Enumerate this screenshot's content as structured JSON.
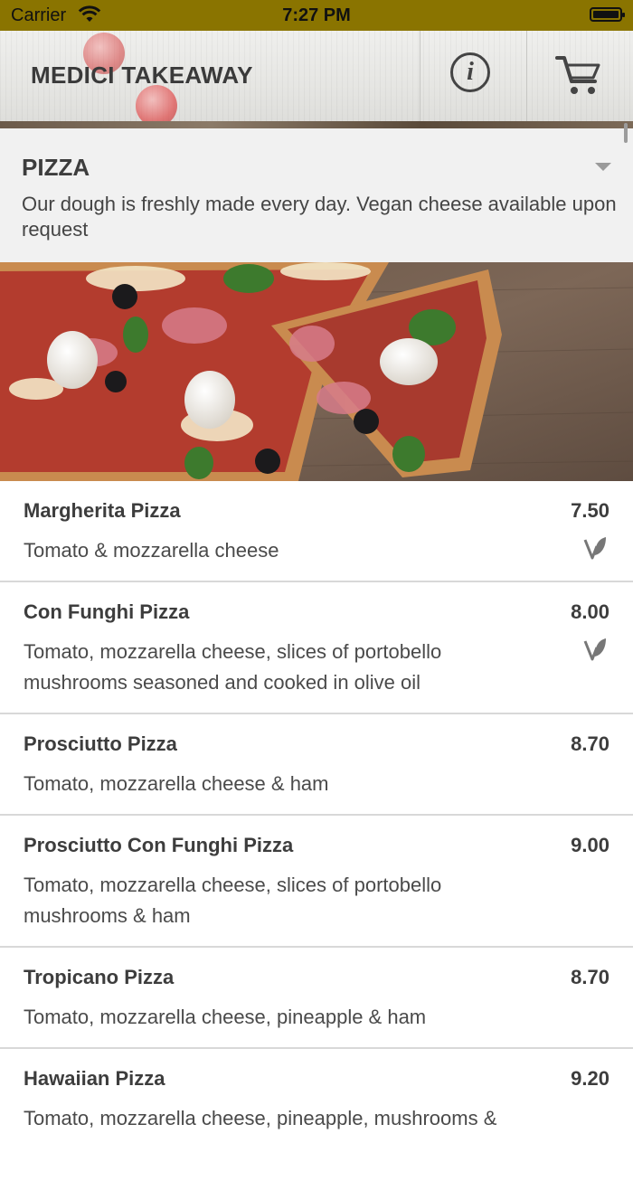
{
  "status_bar": {
    "carrier": "Carrier",
    "time": "7:27 PM"
  },
  "header": {
    "title": "MEDICI TAKEAWAY",
    "info_icon": "info-icon",
    "cart_icon": "cart-icon"
  },
  "category": {
    "title": "PIZZA",
    "description": "Our dough is freshly made every day. Vegan cheese available upon request",
    "toggle_icon": "chevron-down-icon"
  },
  "items": [
    {
      "name": "Margherita Pizza",
      "price": "7.50",
      "description": "Tomato & mozzarella cheese",
      "vegetarian": true
    },
    {
      "name": "Con Funghi Pizza",
      "price": "8.00",
      "description": "Tomato, mozzarella cheese, slices of portobello mushrooms seasoned and cooked in olive oil",
      "vegetarian": true
    },
    {
      "name": "Prosciutto Pizza",
      "price": "8.70",
      "description": "Tomato, mozzarella cheese & ham",
      "vegetarian": false
    },
    {
      "name": "Prosciutto Con Funghi Pizza",
      "price": "9.00",
      "description": "Tomato, mozzarella cheese, slices of portobello mushrooms & ham",
      "vegetarian": false
    },
    {
      "name": "Tropicano Pizza",
      "price": "8.70",
      "description": "Tomato, mozzarella cheese, pineapple & ham",
      "vegetarian": false
    },
    {
      "name": "Hawaiian Pizza",
      "price": "9.20",
      "description": "Tomato, mozzarella cheese, pineapple, mushrooms &",
      "vegetarian": false
    }
  ],
  "colors": {
    "status_bar": "#8a7400",
    "text": "#3d3d3d",
    "category_bg": "#f1f1f1",
    "divider": "#d8d8d8"
  }
}
